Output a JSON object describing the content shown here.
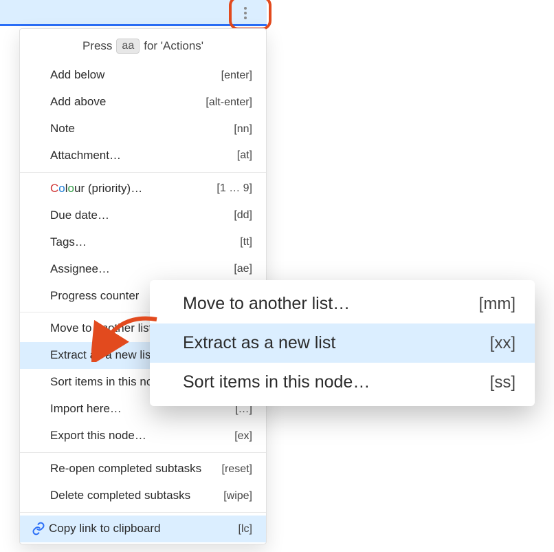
{
  "hint": {
    "pre": "Press",
    "key": "aa",
    "post": "for 'Actions'"
  },
  "groups": [
    [
      {
        "label": "Add below",
        "shortcut": "[enter]"
      },
      {
        "label": "Add above",
        "shortcut": "[alt-enter]"
      },
      {
        "label": "Note",
        "shortcut": "[nn]"
      },
      {
        "label": "Attachment…",
        "shortcut": "[at]"
      }
    ],
    [
      {
        "label_html": "colour",
        "suffix": " (priority)…",
        "shortcut": "[1 … 9]",
        "is_colour": true
      },
      {
        "label": "Due date…",
        "shortcut": "[dd]"
      },
      {
        "label": "Tags…",
        "shortcut": "[tt]"
      },
      {
        "label": "Assignee…",
        "shortcut": "[ae]"
      },
      {
        "label": "Progress counter",
        "shortcut": ""
      }
    ],
    [
      {
        "label": "Move to another list…",
        "shortcut": "[mm]"
      },
      {
        "label": "Extract as a new list",
        "shortcut": "[xx]",
        "selected": true
      },
      {
        "label": "Sort items in this node…",
        "shortcut": "[ss]"
      },
      {
        "label": "Import here…",
        "shortcut": "[…]"
      },
      {
        "label": "Export this node…",
        "shortcut": "[ex]"
      }
    ],
    [
      {
        "label": "Re-open completed subtasks",
        "shortcut": "[reset]"
      },
      {
        "label": "Delete completed subtasks",
        "shortcut": "[wipe]"
      }
    ],
    [
      {
        "label": "Copy link to clipboard",
        "shortcut": "[lc]",
        "icon": "link",
        "selected": true
      }
    ]
  ],
  "zoom": [
    {
      "label": "Move to another list…",
      "shortcut": "[mm]"
    },
    {
      "label": "Extract as a new list",
      "shortcut": "[xx]",
      "selected": true
    },
    {
      "label": "Sort items in this node…",
      "shortcut": "[ss]"
    }
  ]
}
